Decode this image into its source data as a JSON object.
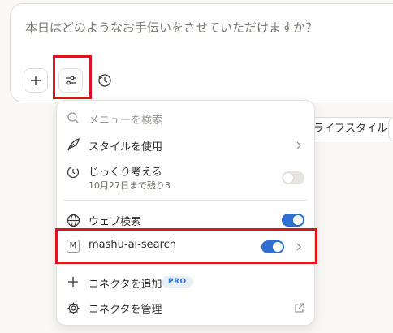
{
  "composer": {
    "placeholder": "本日はどのようなお手伝いをさせていただけますか？"
  },
  "toolbar": {
    "add_icon": "plus-icon",
    "tools_icon": "sliders-icon",
    "history_icon": "clock-icon"
  },
  "suggestions": {
    "visible_chip": "ライフスタイル"
  },
  "menu": {
    "search_placeholder": "メニューを検索",
    "items": [
      {
        "label": "スタイルを使用",
        "icon": "feather-icon"
      },
      {
        "label": "じっくり考える",
        "sub": "10月27日まで残り3",
        "icon": "timer-icon",
        "toggle": false
      },
      {
        "label": "ウェブ検索",
        "icon": "globe-icon",
        "toggle": true
      },
      {
        "label": "mashu-ai-search",
        "icon_letter": "M",
        "toggle": true
      },
      {
        "label": "コネクタを追加",
        "badge": "PRO",
        "icon": "plus-icon"
      },
      {
        "label": "コネクタを管理",
        "icon": "gear-icon"
      }
    ]
  },
  "colors": {
    "accent": "#2f6fd1",
    "highlight": "#d9161c",
    "background": "#f9f8f5"
  }
}
